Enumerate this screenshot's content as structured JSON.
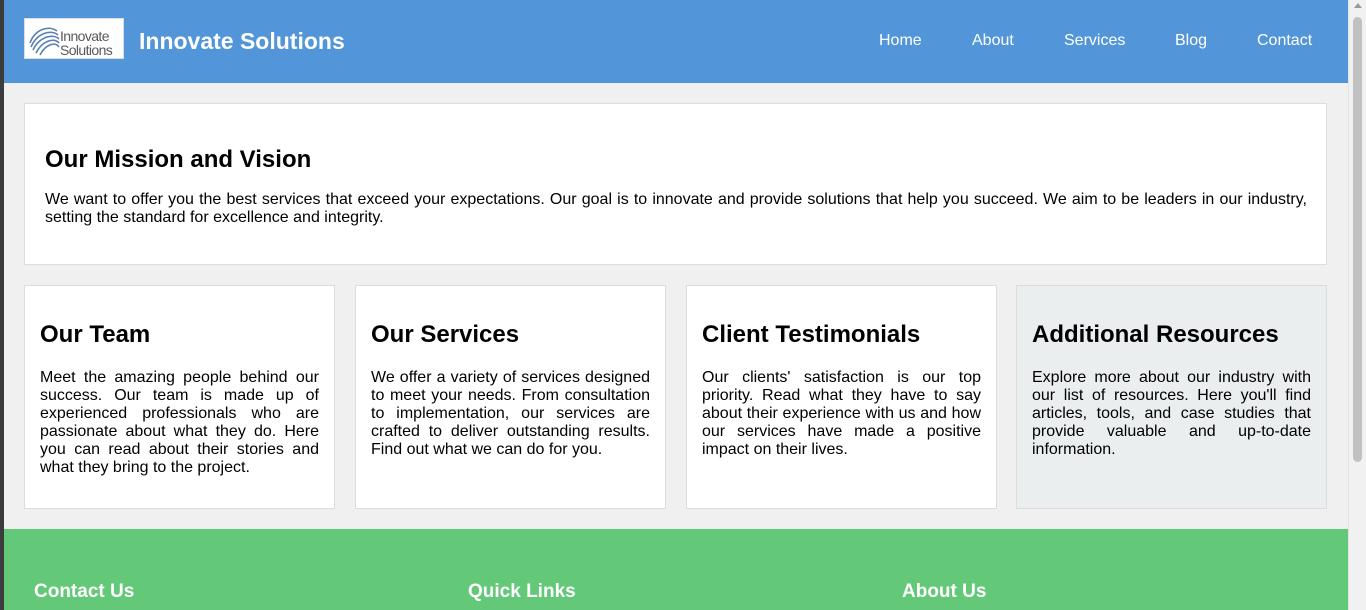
{
  "header": {
    "logo": {
      "line1": "Innovate",
      "line2": "Solutions"
    },
    "brand": "Innovate Solutions",
    "background_color": "#5296d9",
    "nav": [
      {
        "label": "Home"
      },
      {
        "label": "About"
      },
      {
        "label": "Services"
      },
      {
        "label": "Blog"
      },
      {
        "label": "Contact"
      }
    ]
  },
  "mission": {
    "title": "Our Mission and Vision",
    "text": "We want to offer you the best services that exceed your expectations. Our goal is to innovate and provide solutions that help you succeed. We aim to be leaders in our industry, setting the standard for excellence and integrity."
  },
  "cards": [
    {
      "title": "Our Team",
      "text": "Meet the amazing people behind our success. Our team is made up of experienced professionals who are passionate about what they do. Here you can read about their stories and what they bring to the project."
    },
    {
      "title": "Our Services",
      "text": "We offer a variety of services designed to meet your needs. From consultation to implementation, our services are crafted to deliver outstanding results. Find out what we can do for you."
    },
    {
      "title": "Client Testimonials",
      "text": "Our clients' satisfaction is our top priority. Read what they have to say about their experience with us and how our services have made a positive impact on their lives."
    },
    {
      "title": "Additional Resources",
      "text": "Explore more about our industry with our list of resources. Here you'll find articles, tools, and case studies that provide valuable and up-to-date information."
    }
  ],
  "footer": {
    "background_color": "#63c877",
    "sections": [
      {
        "title": "Contact Us"
      },
      {
        "title": "Quick Links"
      },
      {
        "title": "About Us"
      }
    ]
  },
  "scrollbar": {
    "icon": "chevron-up-icon"
  }
}
